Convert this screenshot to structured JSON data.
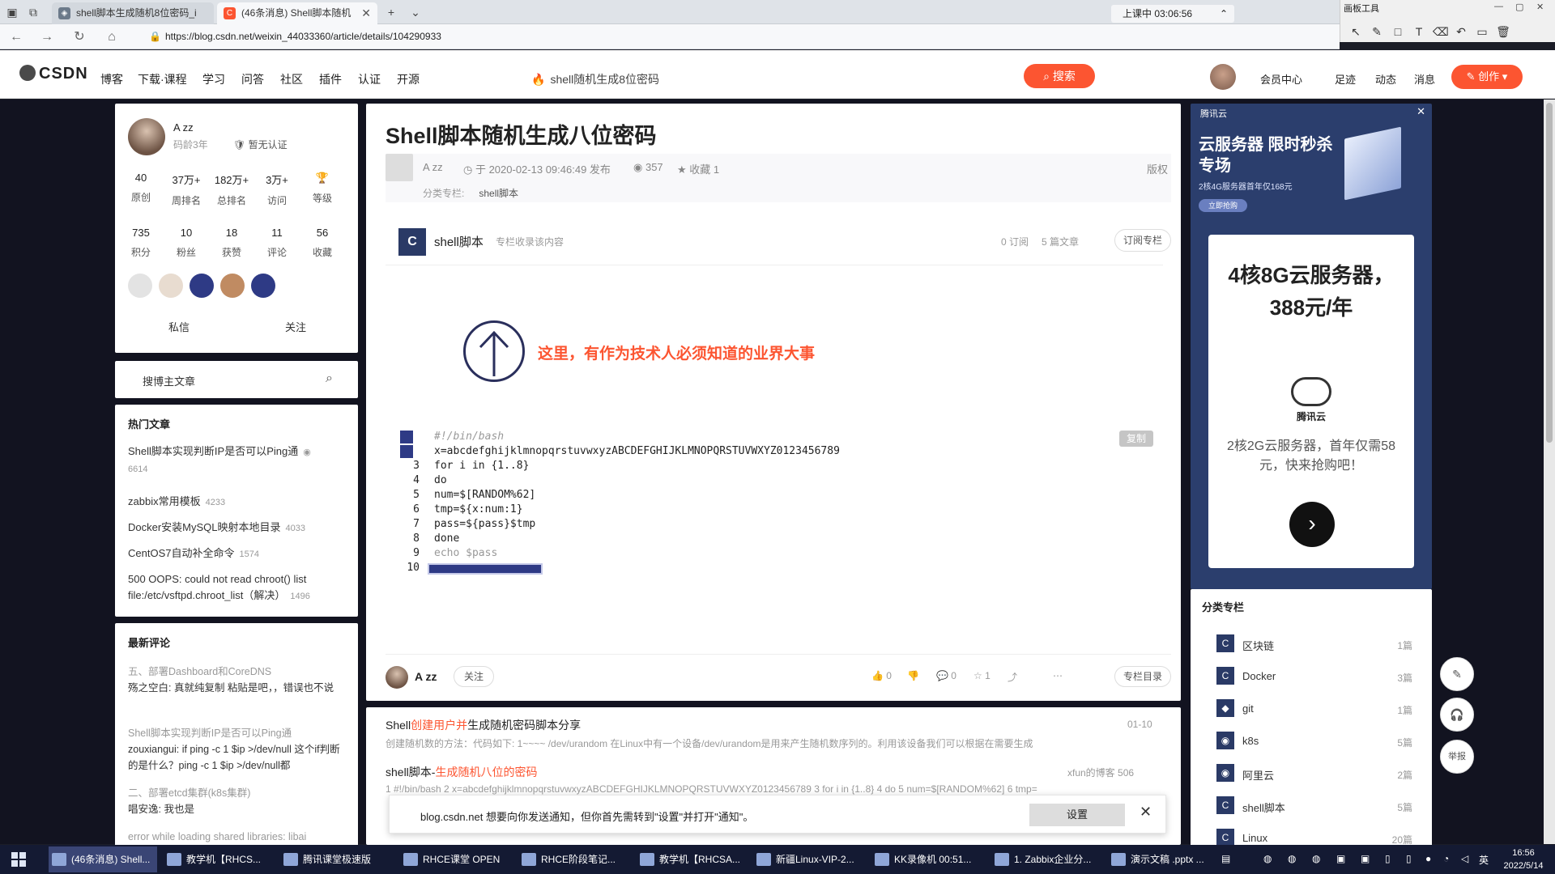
{
  "browser": {
    "tabs": [
      {
        "title": "shell脚本生成随机8位密码_i"
      },
      {
        "title": "(46条消息) Shell脚本随机"
      }
    ],
    "time_pill": "上课中 03:06:56",
    "url": "https://blog.csdn.net/weixin_44033360/article/details/104290933",
    "draw_panel_title": "画板工具"
  },
  "csdn_nav": {
    "logo": "CSDN",
    "items": [
      "博客",
      "下载·课程",
      "学习",
      "问答",
      "社区",
      "插件",
      "认证",
      "开源"
    ],
    "search_text": "shell随机生成8位密码",
    "search_button": "搜索",
    "right_items": [
      "会员中心",
      "足迹",
      "动态",
      "消息"
    ],
    "create_button": "创作"
  },
  "profile": {
    "name": "A zz",
    "age": "码龄3年",
    "cert": "暂无认证",
    "stats_row1": [
      {
        "v": "40",
        "l": "原创"
      },
      {
        "v": "37万+",
        "l": "周排名"
      },
      {
        "v": "182万+",
        "l": "总排名"
      },
      {
        "v": "3万+",
        "l": "访问"
      },
      {
        "v": "",
        "l": "等级"
      }
    ],
    "stats_row2": [
      {
        "v": "735",
        "l": "积分"
      },
      {
        "v": "10",
        "l": "粉丝"
      },
      {
        "v": "18",
        "l": "获赞"
      },
      {
        "v": "11",
        "l": "评论"
      },
      {
        "v": "56",
        "l": "收藏"
      }
    ],
    "actions": [
      "私信",
      "关注"
    ]
  },
  "blog_search": {
    "placeholder": "搜博主文章"
  },
  "hot": {
    "title": "热门文章",
    "items": [
      {
        "text": "Shell脚本实现判断IP是否可以Ping通",
        "count": "6614"
      },
      {
        "text": "zabbix常用模板",
        "count": "4233"
      },
      {
        "text": "Docker安装MySQL映射本地目录",
        "count": "4033"
      },
      {
        "text": "CentOS7自动补全命令",
        "count": "1574"
      },
      {
        "text": "500 OOPS: could not read chroot() list file:/etc/vsftpd.chroot_list（解决）",
        "count": "1496"
      }
    ]
  },
  "comments": {
    "title": "最新评论",
    "items": [
      {
        "topic": "五、部署Dashboard和CoreDNS",
        "body": "殇之空白: 真就纯复制 粘贴是吧，，错误也不说"
      },
      {
        "topic": "Shell脚本实现判断IP是否可以Ping通",
        "body": "zouxiangui: if ping -c 1 $ip >/dev/null 这个if判断的是什么？ping -c 1 $ip >/dev/null都"
      },
      {
        "topic": "二、部署etcd集群(k8s集群)",
        "body": "唱安逸: 我也是"
      },
      {
        "topic": "error while loading shared libraries: libai",
        "body": ""
      }
    ]
  },
  "article": {
    "title": "Shell脚本随机生成八位密码",
    "author": "A zz",
    "published": "于 2020-02-13 09:46:49 发布",
    "views": "357",
    "favorites": "收藏 1",
    "copyright": "版权",
    "category_label": "分类专栏:",
    "category": "shell脚本",
    "column": {
      "icon": "C",
      "name": "shell脚本",
      "sub": "专栏收录该内容",
      "subs": "0 订阅",
      "articles": "5 篇文章",
      "button": "订阅专栏"
    },
    "banner_text": "这里，有作为技术人必须知道的业界大事",
    "copy_button": "复制",
    "code_lines": [
      {
        "n": "1",
        "t": "#!/bin/bash",
        "comment": true
      },
      {
        "n": "2",
        "t": "x=abcdefghijklmnopqrstuvwxyzABCDEFGHIJKLMNOPQRSTUVWXYZ0123456789",
        "comment": false
      },
      {
        "n": "3",
        "t": "for i in {1..8}",
        "comment": false
      },
      {
        "n": "4",
        "t": "do",
        "comment": false
      },
      {
        "n": "5",
        "t": "num=$[RANDOM%62]",
        "comment": false
      },
      {
        "n": "6",
        "t": "tmp=${x:num:1}",
        "comment": false
      },
      {
        "n": "7",
        "t": "pass=${pass}$tmp",
        "comment": false
      },
      {
        "n": "8",
        "t": "done",
        "comment": false
      },
      {
        "n": "9",
        "t": "echo $pass",
        "comment": false
      },
      {
        "n": "10",
        "t": "",
        "comment": false
      }
    ],
    "footer": {
      "author": "A zz",
      "follow": "关注",
      "likes": "0",
      "comments": "0",
      "favs": "1",
      "catalog": "专栏目录"
    }
  },
  "recommendations": [
    {
      "title_pre": "Shell",
      "title_hl": "创建用户并",
      "title_post": "生成随机密码脚本分享",
      "date": "01-10",
      "desc": "创建随机数的方法：代码如下: 1~~~~ /dev/urandom 在Linux中有一个设备/dev/urandom是用来产生随机数序列的。利用该设备我们可以根据在需要生成"
    },
    {
      "title_pre": "shell脚本-",
      "title_hl": "生成随机八位的密码",
      "title_post": "",
      "date": "xfun的博客  506",
      "desc": "1 #!/bin/bash 2 x=abcdefghijklmnopqrstuvwxyzABCDEFGHIJKLMNOPQRSTUVWXYZ0123456789 3 for i in {1..8} 4 do 5 num=$[RANDOM%62] 6 tmp="
    }
  ],
  "ad": {
    "brand": "腾讯云",
    "headline": "云服务器 限时秒杀专场",
    "sub": "2核4G服务器首年仅168元",
    "pill": "立即抢购",
    "big": "4核8G云服务器，388元/年",
    "cloud_text": "腾讯云",
    "desc": "2核2G云服务器，首年仅需58元，快来抢购吧！"
  },
  "categories": {
    "title": "分类专栏",
    "items": [
      {
        "name": "区块链",
        "count": "1篇"
      },
      {
        "name": "Docker",
        "count": "3篇"
      },
      {
        "name": "git",
        "count": "1篇"
      },
      {
        "name": "k8s",
        "count": "5篇"
      },
      {
        "name": "阿里云",
        "count": "2篇"
      },
      {
        "name": "shell脚本",
        "count": "5篇"
      },
      {
        "name": "Linux",
        "count": "20篇"
      }
    ]
  },
  "float_buttons": [
    "举报"
  ],
  "notification": {
    "message": "blog.csdn.net 想要向你发送通知，但你首先需转到\"设置\"并打开\"通知\"。",
    "button": "设置"
  },
  "taskbar": {
    "tasks": [
      "(46条消息) Shell...",
      "教学机【RHCS...",
      "腾讯课堂极速版",
      "RHCE课堂 OPEN",
      "RHCE阶段笔记...",
      "教学机【RHCSA...",
      "新疆Linux-VIP-2...",
      "KK录像机 00:51...",
      "1. Zabbix企业分...",
      "演示文稿 .pptx ..."
    ],
    "lang": "英",
    "time": "16:56",
    "date": "2022/5/14"
  }
}
